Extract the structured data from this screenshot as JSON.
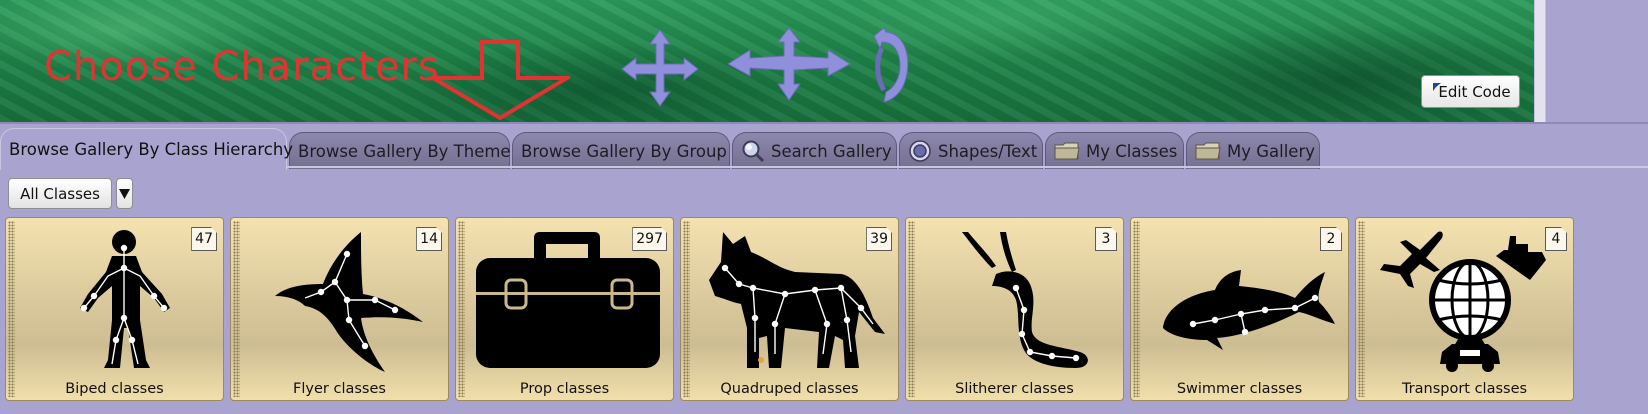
{
  "scene": {
    "title": "Choose Characters",
    "edit_code_label": "Edit Code"
  },
  "tabs": [
    {
      "label": "Browse Gallery By Class Hierarchy",
      "icon": null,
      "active": true
    },
    {
      "label": "Browse Gallery By Theme",
      "icon": null,
      "active": false
    },
    {
      "label": "Browse Gallery By Group",
      "icon": null,
      "active": false
    },
    {
      "label": "Search Gallery",
      "icon": "magnifier-icon",
      "active": false
    },
    {
      "label": "Shapes/Text",
      "icon": "shapes-icon",
      "active": false
    },
    {
      "label": "My Classes",
      "icon": "folder-icon",
      "active": false
    },
    {
      "label": "My Gallery",
      "icon": "folder-icon",
      "active": false
    }
  ],
  "filter": {
    "selected": "All Classes"
  },
  "gallery": {
    "cards": [
      {
        "label": "Biped classes",
        "count": "47",
        "icon": "biped-icon"
      },
      {
        "label": "Flyer classes",
        "count": "14",
        "icon": "flyer-icon"
      },
      {
        "label": "Prop classes",
        "count": "297",
        "icon": "prop-icon"
      },
      {
        "label": "Quadruped classes",
        "count": "39",
        "icon": "quadruped-icon"
      },
      {
        "label": "Slitherer classes",
        "count": "3",
        "icon": "slitherer-icon"
      },
      {
        "label": "Swimmer classes",
        "count": "2",
        "icon": "swimmer-icon"
      },
      {
        "label": "Transport classes",
        "count": "4",
        "icon": "transport-icon"
      }
    ]
  },
  "colors": {
    "title_red": "#e23232",
    "panel_bg": "#a9a4cf",
    "card_tan": "#dac99c",
    "control_purple": "#8f8fdc"
  }
}
